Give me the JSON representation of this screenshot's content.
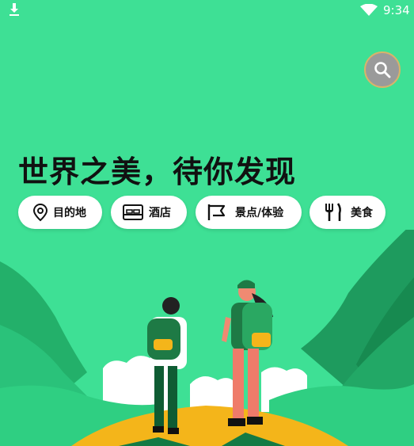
{
  "status_bar": {
    "time": "9:34"
  },
  "headline": "世界之美，待你发现",
  "categories": [
    {
      "label": "目的地",
      "icon": "location-pin-icon"
    },
    {
      "label": "酒店",
      "icon": "bed-icon"
    },
    {
      "label": "景点/体验",
      "icon": "flag-icon"
    },
    {
      "label": "美食",
      "icon": "fork-knife-icon"
    }
  ],
  "search": {
    "icon": "search-icon"
  },
  "colors": {
    "background": "#3ee095",
    "search_button": "#9a9a9a",
    "hill_dark": "#1e9b5e",
    "path_yellow": "#f4b51a"
  }
}
